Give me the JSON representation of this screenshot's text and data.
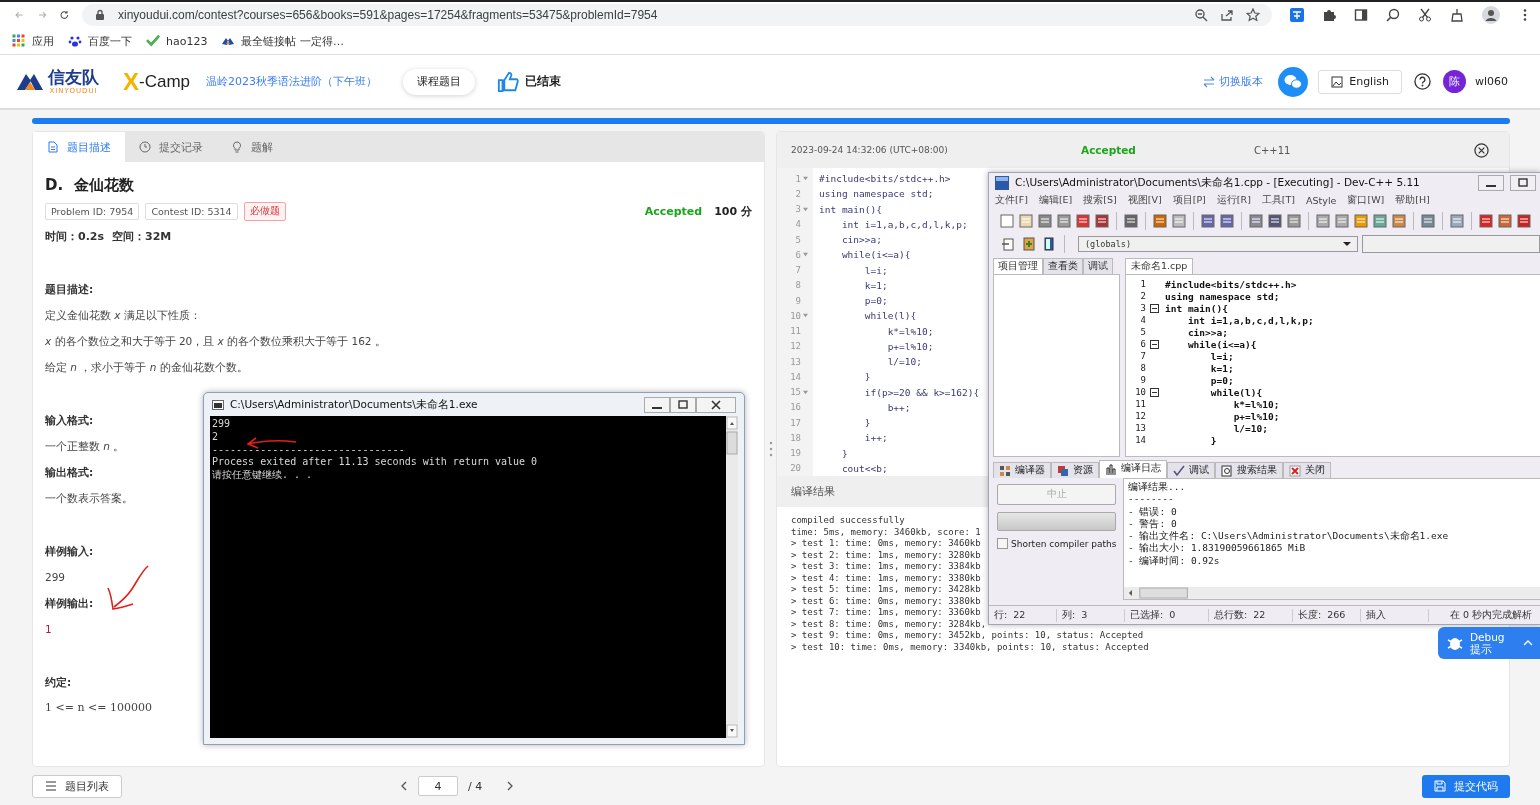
{
  "browser": {
    "url": "xinyoudui.com/contest?courses=656&books=591&pages=17254&fragments=53475&problemId=7954",
    "bookmarks": [
      {
        "label": "应用"
      },
      {
        "label": "百度一下"
      },
      {
        "label": "hao123"
      },
      {
        "label": "最全链接帖 一定得…"
      }
    ]
  },
  "header": {
    "logo": "信友队",
    "logo_sub": "XINYOUDUI",
    "brand_mark": "X",
    "brand_name": "-Camp",
    "course": "温岭2023秋季语法进阶（下午班）",
    "course_button": "课程题目",
    "status": "已结束",
    "switch": "切换版本",
    "language": "English",
    "avatar": "陈",
    "user": "wl060"
  },
  "progress": {
    "level": 1
  },
  "problem": {
    "tabs": [
      {
        "label": "题目描述",
        "selected": true
      },
      {
        "label": "提交记录",
        "selected": false
      },
      {
        "label": "题解",
        "selected": false
      }
    ],
    "title": "D.  金仙花数",
    "tags": [
      {
        "label": "Problem ID: 7954",
        "kind": "info"
      },
      {
        "label": "Contest ID: 5314",
        "kind": "info"
      },
      {
        "label": "必做题",
        "kind": "required"
      }
    ],
    "verdict": "Accepted",
    "score": "100 分",
    "limits": [
      {
        "label": "时间：",
        "value": "0.2s"
      },
      {
        "label": "空间：",
        "value": "32M"
      }
    ],
    "sections": [
      {
        "heading": "题目描述:",
        "paragraphs": [
          {
            "kind": "text",
            "text": "定义金仙花数 *x* 满足以下性质："
          },
          {
            "kind": "text",
            "text": "*x* 的各个数位之和大于等于 20，且 *x* 的各个数位乘积大于等于 162 。"
          },
          {
            "kind": "text",
            "text": "给定 *n* ，求小于等于 *n* 的金仙花数个数。"
          }
        ]
      },
      {
        "heading": "输入格式:",
        "paragraphs": [
          {
            "kind": "text",
            "text": "一个正整数 *n* 。"
          }
        ]
      },
      {
        "heading": "输出格式:",
        "paragraphs": [
          {
            "kind": "text",
            "text": "一个数表示答案。"
          }
        ]
      },
      {
        "heading": "样例输入:",
        "paragraphs": [
          {
            "kind": "text",
            "text": "299"
          }
        ]
      },
      {
        "heading": "样例输出:",
        "paragraphs": [
          {
            "kind": "output",
            "text": "1"
          }
        ]
      },
      {
        "heading": "约定:",
        "paragraphs": [
          {
            "kind": "math",
            "text": "1 <= n <= 100000"
          }
        ]
      }
    ]
  },
  "submission": {
    "time": "2023-09-24 14:32:06 (UTC+08:00)",
    "verdict": "Accepted",
    "language": "C++11",
    "code": [
      {
        "n": "1",
        "text": "#include<bits/stdc++.h>",
        "fold": true
      },
      {
        "n": "2",
        "text": "using namespace std;",
        "fold": false
      },
      {
        "n": "3",
        "text": "int main(){",
        "fold": true
      },
      {
        "n": "4",
        "text": "    int i=1,a,b,c,d,l,k,p;",
        "fold": false
      },
      {
        "n": "5",
        "text": "    cin>>a;",
        "fold": false
      },
      {
        "n": "6",
        "text": "    while(i<=a){",
        "fold": true
      },
      {
        "n": "7",
        "text": "        l=i;",
        "fold": false
      },
      {
        "n": "8",
        "text": "        k=1;",
        "fold": false
      },
      {
        "n": "9",
        "text": "        p=0;",
        "fold": false
      },
      {
        "n": "10",
        "text": "        while(l){",
        "fold": true
      },
      {
        "n": "11",
        "text": "            k*=l%10;",
        "fold": false
      },
      {
        "n": "12",
        "text": "            p+=l%10;",
        "fold": false
      },
      {
        "n": "13",
        "text": "            l/=10;",
        "fold": false
      },
      {
        "n": "14",
        "text": "        }",
        "fold": false
      },
      {
        "n": "15",
        "text": "        if(p>=20 && k>=162){",
        "fold": true
      },
      {
        "n": "16",
        "text": "            b++;",
        "fold": false
      },
      {
        "n": "17",
        "text": "        }",
        "fold": false
      },
      {
        "n": "18",
        "text": "        i++;",
        "fold": false
      },
      {
        "n": "19",
        "text": "    }",
        "fold": false
      },
      {
        "n": "20",
        "text": "    cout<<b;",
        "fold": false
      }
    ],
    "result_title": "编译结果",
    "result": [
      "compiled successfully",
      "time: 5ms, memory: 3460kb, score: 1",
      "> test 1: time: 0ms, memory: 3460kb",
      "> test 2: time: 1ms, memory: 3280kb",
      "> test 3: time: 1ms, memory: 3384kb",
      "> test 4: time: 1ms, memory: 3380kb",
      "> test 5: time: 1ms, memory: 3428kb",
      "> test 6: time: 0ms, memory: 3380kb",
      "> test 7: time: 1ms, memory: 3360kb",
      "> test 8: time: 0ms, memory: 3284kb,",
      "> test 9: time: 0ms, memory: 3452kb, points: 10, status: Accepted",
      "> test 10: time: 0ms, memory: 3340kb, points: 10, status: Accepted"
    ]
  },
  "console": {
    "title": "C:\\Users\\Administrator\\Documents\\未命名1.exe",
    "lines": [
      "299",
      "2",
      "--------------------------------",
      "Process exited after 11.13 seconds with return value 0",
      "请按任意键继续. . ."
    ]
  },
  "devcpp": {
    "title": "C:\\Users\\Administrator\\Documents\\未命名1.cpp - [Executing] - Dev-C++ 5.11",
    "menu": [
      "文件[F]",
      "编辑[E]",
      "搜索[S]",
      "视图[V]",
      "项目[P]",
      "运行[R]",
      "工具[T]",
      "AStyle",
      "窗口[W]",
      "帮助[H]"
    ],
    "scope": "(globals)",
    "side_tabs": [
      {
        "label": "项目管理",
        "selected": true
      },
      {
        "label": "查看类",
        "selected": false
      },
      {
        "label": "调试",
        "selected": false
      }
    ],
    "file_tab": "未命名1.cpp",
    "code": [
      {
        "n": "1",
        "text": "#include<bits/stdc++.h>",
        "fold": false
      },
      {
        "n": "2",
        "text": "using namespace std;",
        "fold": false
      },
      {
        "n": "3",
        "text": "int main(){",
        "fold": true
      },
      {
        "n": "4",
        "text": "    int i=1,a,b,c,d,l,k,p;",
        "fold": false
      },
      {
        "n": "5",
        "text": "    cin>>a;",
        "fold": false
      },
      {
        "n": "6",
        "text": "    while(i<=a){",
        "fold": true
      },
      {
        "n": "7",
        "text": "        l=i;",
        "fold": false
      },
      {
        "n": "8",
        "text": "        k=1;",
        "fold": false
      },
      {
        "n": "9",
        "text": "        p=0;",
        "fold": false
      },
      {
        "n": "10",
        "text": "        while(l){",
        "fold": true
      },
      {
        "n": "11",
        "text": "            k*=l%10;",
        "fold": false
      },
      {
        "n": "12",
        "text": "            p+=l%10;",
        "fold": false
      },
      {
        "n": "13",
        "text": "            l/=10;",
        "fold": false
      },
      {
        "n": "14",
        "text": "        }",
        "fold": false
      }
    ],
    "bottom_tabs": [
      {
        "label": "编译器",
        "selected": false
      },
      {
        "label": "资源",
        "selected": false
      },
      {
        "label": "编译日志",
        "selected": true
      },
      {
        "label": "调试",
        "selected": false
      },
      {
        "label": "搜索结果",
        "selected": false
      },
      {
        "label": "关闭",
        "selected": false
      }
    ],
    "compile_progress": {
      "level": 0
    },
    "abort_button": {
      "label": "中止",
      "disabled": true
    },
    "shorten_paths": {
      "label": "Shorten compiler paths",
      "checked": false
    },
    "log": [
      "编译结果...",
      "--------",
      "- 错误: 0",
      "- 警告: 0",
      "- 输出文件名: C:\\Users\\Administrator\\Documents\\未命名1.exe",
      "- 输出大小: 1.83190059661865 MiB",
      "- 编译时间: 0.92s"
    ],
    "status": [
      {
        "label": "行:",
        "value": "22"
      },
      {
        "label": "列:",
        "value": "3"
      },
      {
        "label": "已选择:",
        "value": "0"
      },
      {
        "label": "总行数:",
        "value": "22"
      },
      {
        "label": "长度:",
        "value": "266"
      },
      {
        "label": "插入"
      },
      {
        "label": "在 0 秒内完成解析"
      }
    ]
  },
  "debug_popup": {
    "title": "Debug",
    "subtitle": "提示"
  },
  "footer": {
    "list_button": "题目列表",
    "page": "4",
    "total": "/ 4",
    "submit": "提交代码"
  }
}
